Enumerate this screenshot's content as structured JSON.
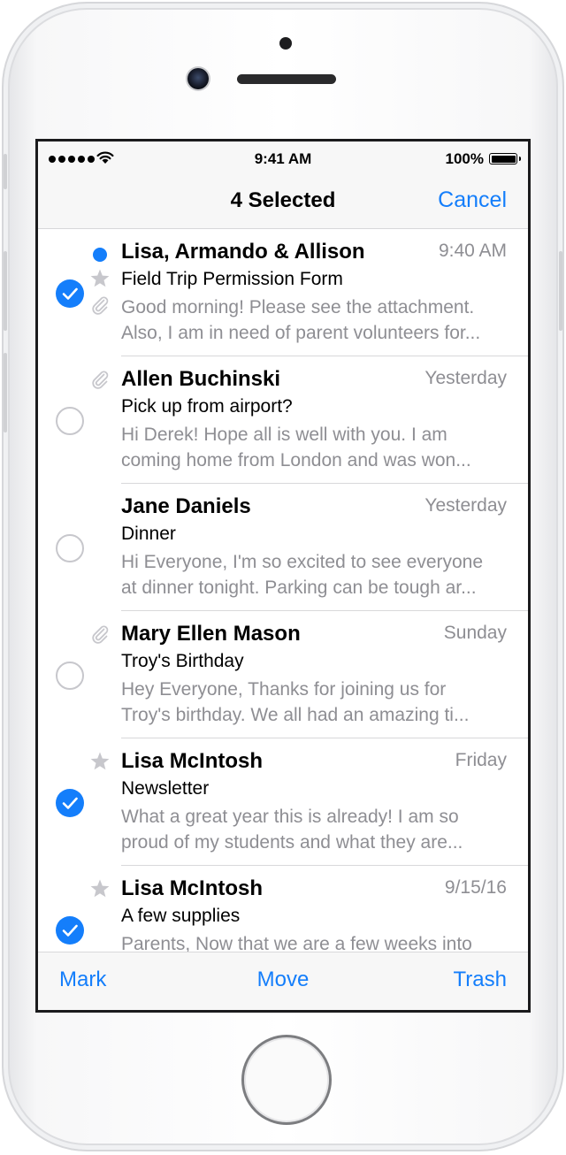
{
  "status_bar": {
    "time": "9:41 AM",
    "battery_percent": "100%",
    "battery_level": 1.0
  },
  "nav": {
    "title": "4 Selected",
    "cancel_label": "Cancel"
  },
  "messages": [
    {
      "sender": "Lisa, Armando & Allison",
      "date": "9:40 AM",
      "subject": "Field Trip Permission Form",
      "preview_line1": "Good morning! Please see the attachment.",
      "preview_line2": "Also, I am in need of parent volunteers for...",
      "selected": true,
      "unread": true,
      "starred": true,
      "attachment": true
    },
    {
      "sender": "Allen Buchinski",
      "date": "Yesterday",
      "subject": "Pick up from airport?",
      "preview_line1": "Hi Derek! Hope all is well with you. I am",
      "preview_line2": "coming home from London and was won...",
      "selected": false,
      "unread": false,
      "starred": false,
      "attachment": true
    },
    {
      "sender": "Jane Daniels",
      "date": "Yesterday",
      "subject": "Dinner",
      "preview_line1": "Hi Everyone, I'm so excited to see everyone",
      "preview_line2": "at dinner tonight. Parking can be tough ar...",
      "selected": false,
      "unread": false,
      "starred": false,
      "attachment": false
    },
    {
      "sender": "Mary Ellen Mason",
      "date": "Sunday",
      "subject": "Troy's Birthday",
      "preview_line1": "Hey Everyone, Thanks for joining us for",
      "preview_line2": "Troy's birthday. We all had an amazing ti...",
      "selected": false,
      "unread": false,
      "starred": false,
      "attachment": true
    },
    {
      "sender": "Lisa McIntosh",
      "date": "Friday",
      "subject": "Newsletter",
      "preview_line1": "What a great year this is already! I am so",
      "preview_line2": "proud of my students and what they are...",
      "selected": true,
      "unread": false,
      "starred": true,
      "attachment": false
    },
    {
      "sender": "Lisa McIntosh",
      "date": "9/15/16",
      "subject": "A few supplies",
      "preview_line1": "Parents, Now that we are a few weeks into",
      "preview_line2": "",
      "selected": true,
      "unread": false,
      "starred": true,
      "attachment": false
    }
  ],
  "toolbar": {
    "mark_label": "Mark",
    "move_label": "Move",
    "trash_label": "Trash"
  },
  "colors": {
    "accent": "#147efb",
    "secondary_text": "#8e8e93",
    "bar_background": "#f7f7f7"
  },
  "icons": {
    "check": "checkmark-icon",
    "star": "star-icon",
    "attachment": "paperclip-icon",
    "unread": "unread-dot-icon"
  }
}
